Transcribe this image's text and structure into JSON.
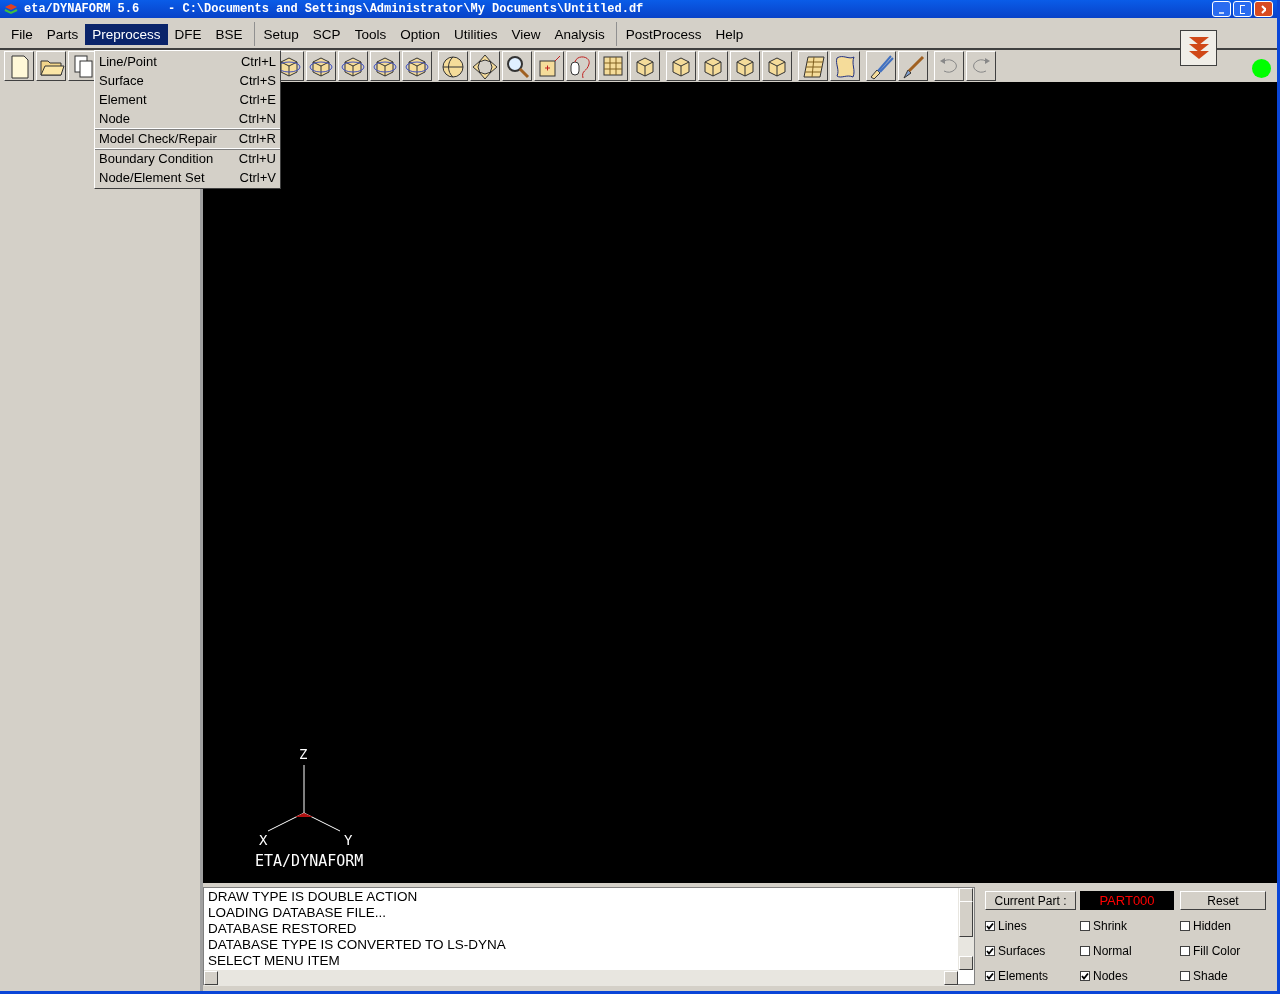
{
  "window": {
    "title": "eta/DYNAFORM 5.6    - C:\\Documents and Settings\\Administrator\\My Documents\\Untitled.df"
  },
  "menu_groups": [
    [
      {
        "label": "File",
        "selected": false
      },
      {
        "label": "Parts",
        "selected": false
      },
      {
        "label": "Preprocess",
        "selected": true
      },
      {
        "label": "DFE",
        "selected": false
      },
      {
        "label": "BSE",
        "selected": false
      }
    ],
    [
      {
        "label": "Setup",
        "selected": false
      },
      {
        "label": "SCP",
        "selected": false
      },
      {
        "label": "Tools",
        "selected": false
      },
      {
        "label": "Option",
        "selected": false
      },
      {
        "label": "Utilities",
        "selected": false
      },
      {
        "label": "View",
        "selected": false
      },
      {
        "label": "Analysis",
        "selected": false
      }
    ],
    [
      {
        "label": "PostProcess",
        "selected": false
      },
      {
        "label": "Help",
        "selected": false
      }
    ]
  ],
  "dropdown_groups": [
    [
      {
        "label": "Line/Point",
        "shortcut": "Ctrl+L"
      },
      {
        "label": "Surface",
        "shortcut": "Ctrl+S"
      },
      {
        "label": "Element",
        "shortcut": "Ctrl+E"
      },
      {
        "label": "Node",
        "shortcut": "Ctrl+N"
      }
    ],
    [
      {
        "label": "Model Check/Repair",
        "shortcut": "Ctrl+R"
      }
    ],
    [
      {
        "label": "Boundary Condition",
        "shortcut": "Ctrl+U"
      },
      {
        "label": "Node/Element Set",
        "shortcut": "Ctrl+V"
      }
    ]
  ],
  "viewport": {
    "axes": {
      "z": "Z",
      "x": "X",
      "y": "Y"
    },
    "logo": "ETA/DYNAFORM"
  },
  "log": [
    "DRAW TYPE IS DOUBLE ACTION",
    "LOADING DATABASE FILE...",
    "DATABASE RESTORED",
    "DATABASE TYPE IS CONVERTED TO LS-DYNA",
    "SELECT MENU ITEM"
  ],
  "display_panel": {
    "current_part_button": "Current Part :",
    "current_part": "PART000",
    "reset_button": "Reset",
    "options": [
      {
        "label": "Lines",
        "checked": true
      },
      {
        "label": "Shrink",
        "checked": false
      },
      {
        "label": "Hidden",
        "checked": false
      },
      {
        "label": "Surfaces",
        "checked": true
      },
      {
        "label": "Normal",
        "checked": false
      },
      {
        "label": "Fill Color",
        "checked": false
      },
      {
        "label": "Elements",
        "checked": true
      },
      {
        "label": "Nodes",
        "checked": true
      },
      {
        "label": "Shade",
        "checked": false
      }
    ]
  }
}
